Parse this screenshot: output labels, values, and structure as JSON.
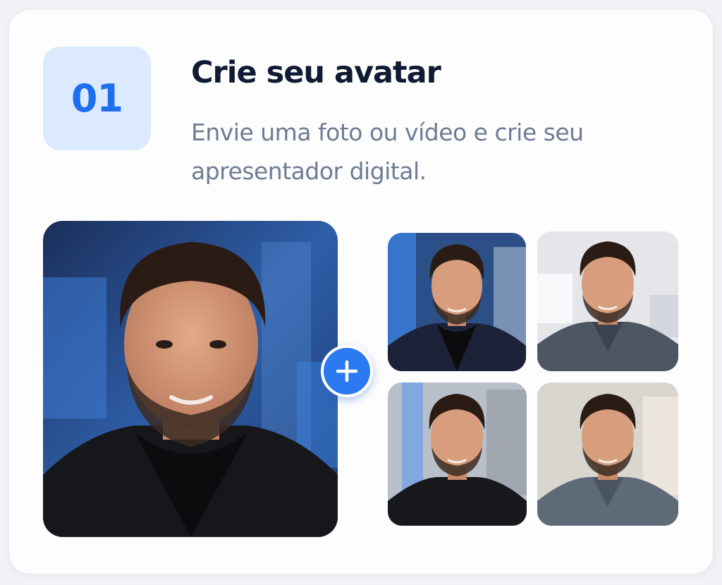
{
  "step": {
    "number": "01",
    "title": "Crie seu avatar",
    "description": "Envie uma foto ou vídeo e crie seu apresentador digital."
  },
  "images": {
    "main_photo": "avatar-source-photo",
    "variants": [
      "avatar-variant-office-dark",
      "avatar-variant-studio-shirt",
      "avatar-variant-office-tee",
      "avatar-variant-studio-shirt-2"
    ]
  },
  "icons": {
    "plus": "plus-icon"
  },
  "colors": {
    "accent": "#2b7af2",
    "badge_bg": "#dceaff",
    "badge_text": "#1d6ff0",
    "title": "#0f1a33",
    "description": "#6f7b93"
  }
}
